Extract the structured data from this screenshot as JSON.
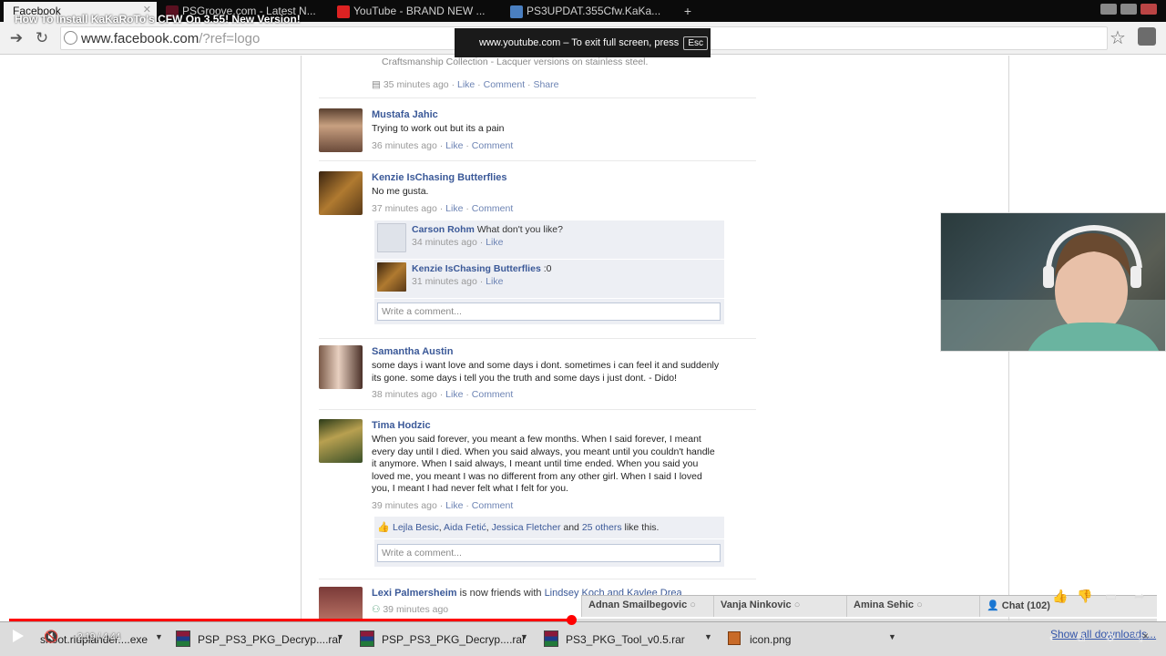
{
  "browser": {
    "tabs": [
      {
        "label": "Facebook",
        "active": true
      },
      {
        "label": "PSGroove.com - Latest N...",
        "active": false
      },
      {
        "label": "YouTube - BRAND NEW ...",
        "active": false
      },
      {
        "label": "PS3UPDAT.355Cfw.KaKa...",
        "active": false
      }
    ],
    "new_tab": "+",
    "url_host": "www.facebook.com",
    "url_rest": "/?ref=logo"
  },
  "video": {
    "title": "How To Install KaKaRoTo's CFW On 3.55! New Version!",
    "time": "2:19 / 4:44",
    "progress": 0.49
  },
  "fullscreen_notice": {
    "text": "www.youtube.com – To exit full screen, press",
    "key": "Esc"
  },
  "feed": {
    "truncated_text": "Craftsmanship Collection - Lacquer versions on stainless steel.",
    "truncated_meta": {
      "time": "35 minutes ago",
      "like": "Like",
      "comment": "Comment",
      "share": "Share"
    },
    "posts": [
      {
        "author": "Mustafa Jahic",
        "text": "Trying to work out but its a pain",
        "time": "36 minutes ago",
        "like": "Like",
        "comment": "Comment"
      },
      {
        "author": "Kenzie IsChasing Butterflies",
        "text": "No me gusta.",
        "time": "37 minutes ago",
        "like": "Like",
        "comment": "Comment",
        "comments": [
          {
            "name": "Carson Rohm",
            "text": "What don't you like?",
            "time": "34 minutes ago",
            "like": "Like"
          },
          {
            "name": "Kenzie IsChasing Butterflies",
            "text": ":0",
            "time": "31 minutes ago",
            "like": "Like"
          }
        ],
        "comment_placeholder": "Write a comment..."
      },
      {
        "author": "Samantha Austin",
        "text_line1": "some days i want love and some days i dont. sometimes i can feel it and suddenly",
        "text_line2": "its gone. some days i tell you the truth and some days i just dont. - Dido!",
        "time": "38 minutes ago",
        "like": "Like",
        "comment": "Comment"
      },
      {
        "author": "Tima Hodzic",
        "lines": [
          "When you said forever, you meant a few months. When I said forever, I meant",
          "every day until I died. When you said always, you meant until you couldn't handle",
          "it anymore. When I said always, I meant until time ended. When you said you",
          "loved me, you meant I was no different from any other girl. When I said I loved",
          "you, I meant I had never felt what I felt for you."
        ],
        "time": "39 minutes ago",
        "like": "Like",
        "comment": "Comment",
        "likers": {
          "name1": "Lejla Besic",
          "name2": "Aida Fetić",
          "name3": "Jessica Fletcher",
          "and": "and",
          "others": "25 others",
          "suffix": "like this."
        },
        "comment_placeholder": "Write a comment..."
      },
      {
        "author": "Lexi Palmersheim",
        "activity": "is now friends with",
        "friends": "Lindsey Koch and Kaylee Drea",
        "time": "39 minutes ago"
      }
    ]
  },
  "chat": {
    "friends": [
      "Adnan Smailbegovic",
      "Vanja Ninkovic",
      "Amina Sehic"
    ],
    "label": "Chat (102)"
  },
  "downloads": {
    "items": [
      {
        "name": "shoot.riuplander....exe",
        "type": "exe"
      },
      {
        "name": "PSP_PS3_PKG_Decryp....rar",
        "type": "rar"
      },
      {
        "name": "PSP_PS3_PKG_Decryp....rar",
        "type": "rar"
      },
      {
        "name": "PS3_PKG_Tool_v0.5.rar",
        "type": "rar"
      },
      {
        "name": "icon.png",
        "type": "png"
      }
    ],
    "show_all": "Show all downloads...",
    "close": "×"
  },
  "colors": {
    "facebook_blue": "#3b5998",
    "link": "#6d84b4",
    "progress": "#ff0000"
  }
}
